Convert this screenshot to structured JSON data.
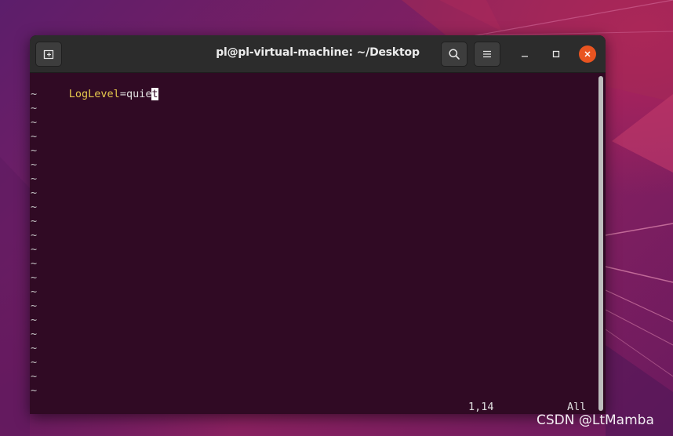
{
  "window": {
    "title": "pl@pl-virtual-machine: ~/Desktop"
  },
  "editor": {
    "first_line": {
      "key": "LogLevel",
      "eq": "=",
      "value_before_cursor": "quie",
      "cursor_char": "t"
    },
    "empty_line_marker": "~",
    "status_position": "1,14",
    "status_scroll": "All"
  },
  "watermark": "CSDN @LtMamba",
  "colors": {
    "terminal_bg": "#300a24",
    "keyword": "#e6c94d",
    "close_button": "#e95420",
    "titlebar": "#2c2c2c"
  },
  "icons": {
    "new_tab": "new-tab-icon",
    "search": "search-icon",
    "menu": "hamburger-menu-icon",
    "minimize": "minimize-icon",
    "maximize": "maximize-icon",
    "close": "close-icon"
  }
}
